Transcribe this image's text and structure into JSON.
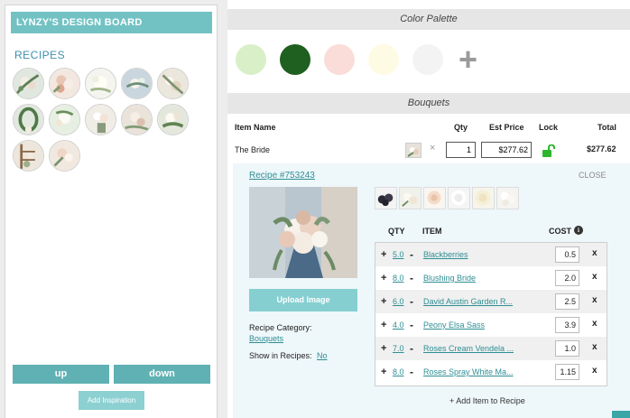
{
  "board": {
    "title": "LYNZY'S DESIGN BOARD",
    "recipes_label": "RECIPES",
    "up_label": "up",
    "down_label": "down",
    "add_inspiration_label": "Add Inspiration"
  },
  "palette": {
    "header": "Color Palette",
    "colors": [
      "#d9efc8",
      "#1f5f1f",
      "#fadcd8",
      "#fdfbe3",
      "#f3f3f3"
    ],
    "add_symbol": "+"
  },
  "bouquets": {
    "header": "Bouquets",
    "columns": {
      "item_name": "Item Name",
      "qty": "Qty",
      "est_price": "Est Price",
      "lock": "Lock",
      "total": "Total"
    },
    "row": {
      "name": "The Bride",
      "remove_symbol": "×",
      "qty": "1",
      "price": "$277.62",
      "total": "$277.62"
    }
  },
  "recipe": {
    "link": "Recipe #753243",
    "close_label": "CLOSE",
    "upload_label": "Upload Image",
    "category_label": "Recipe Category:",
    "category_value": "Bouquets",
    "show_label": "Show in Recipes:",
    "show_value": "No",
    "table_headers": {
      "qty": "QTY",
      "item": "ITEM",
      "cost": "COST"
    },
    "info_symbol": "i",
    "ingredients": [
      {
        "qty": "5.0",
        "name": "Blackberries",
        "cost": "0.5"
      },
      {
        "qty": "8.0",
        "name": "Blushing Bride",
        "cost": "2.0"
      },
      {
        "qty": "6.0",
        "name": "David Austin Garden R...",
        "cost": "2.5"
      },
      {
        "qty": "4.0",
        "name": "Peony Elsa Sass",
        "cost": "3.9"
      },
      {
        "qty": "7.0",
        "name": "Roses Cream Vendela ...",
        "cost": "1.0"
      },
      {
        "qty": "8.0",
        "name": "Roses Spray White Ma...",
        "cost": "1.15"
      }
    ],
    "row_plus": "+",
    "row_minus": "-",
    "row_remove": "x",
    "add_item_label": "+ Add Item to Recipe"
  },
  "colors": {
    "accent": "#72c2c4",
    "button": "#5fb1b3",
    "link": "#2f8e94",
    "lock_green": "#2db52d"
  }
}
